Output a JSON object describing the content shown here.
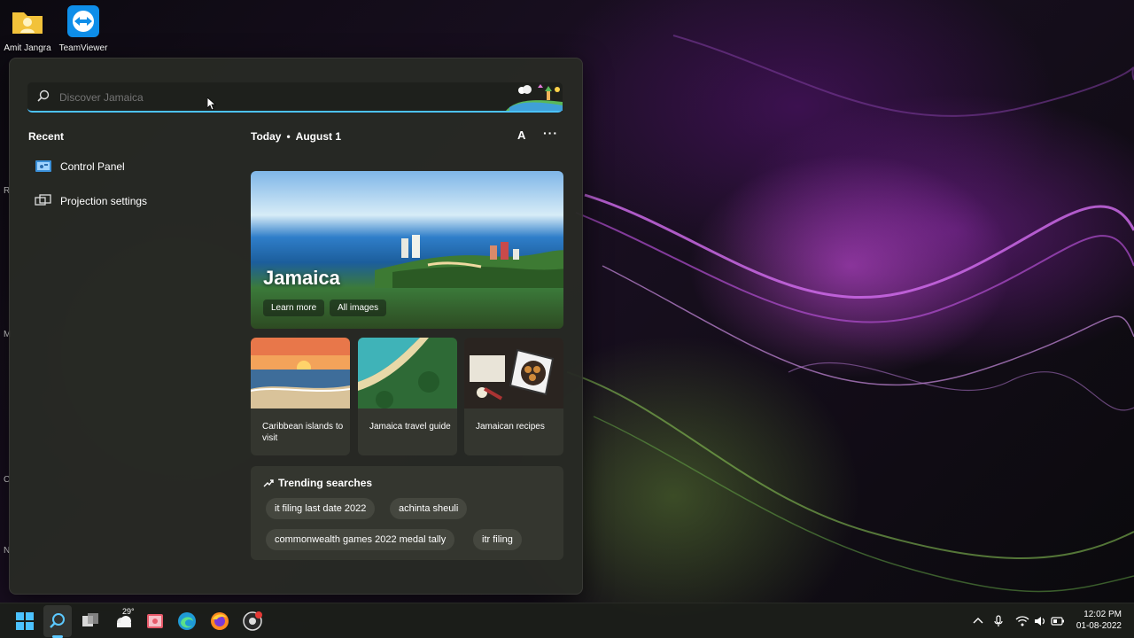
{
  "desktop": {
    "icons": [
      {
        "label": "Amit Jangra",
        "icon": "user-folder-icon"
      },
      {
        "label": "TeamViewer",
        "icon": "teamviewer-icon"
      }
    ],
    "edge_letters": [
      "R",
      "M",
      "C",
      "N"
    ]
  },
  "search": {
    "placeholder": "Discover Jamaica",
    "value": "",
    "icon": "search-icon"
  },
  "recent": {
    "title": "Recent",
    "items": [
      {
        "label": "Control Panel",
        "icon": "control-panel-icon"
      },
      {
        "label": "Projection settings",
        "icon": "projection-icon"
      }
    ]
  },
  "today": {
    "label": "Today",
    "separator": "•",
    "date": "August 1",
    "font_button": "A",
    "more_button": "···"
  },
  "hero": {
    "title": "Jamaica",
    "buttons": [
      "Learn more",
      "All images"
    ]
  },
  "cards": [
    {
      "label": "Caribbean islands to visit"
    },
    {
      "label": "Jamaica travel guide"
    },
    {
      "label": "Jamaican recipes"
    }
  ],
  "trending": {
    "title": "Trending searches",
    "chips": [
      "it filing last date 2022",
      "achinta sheuli",
      "commonwealth games 2022 medal tally",
      "itr filing"
    ]
  },
  "taskbar": {
    "weather_temp": "29°",
    "apps": [
      "start-icon",
      "search-icon",
      "task-view-icon",
      "weather-icon",
      "photos-icon",
      "edge-icon",
      "firefox-icon",
      "chrome-icon"
    ],
    "tray": [
      "chevron-up-icon",
      "microphone-icon",
      "wifi-icon",
      "volume-icon",
      "battery-icon"
    ],
    "time": "12:02 PM",
    "date": "01-08-2022"
  },
  "colors": {
    "accent": "#4cc2ff",
    "panel_bg": "#2a2c26",
    "card_bg": "#34362f"
  }
}
